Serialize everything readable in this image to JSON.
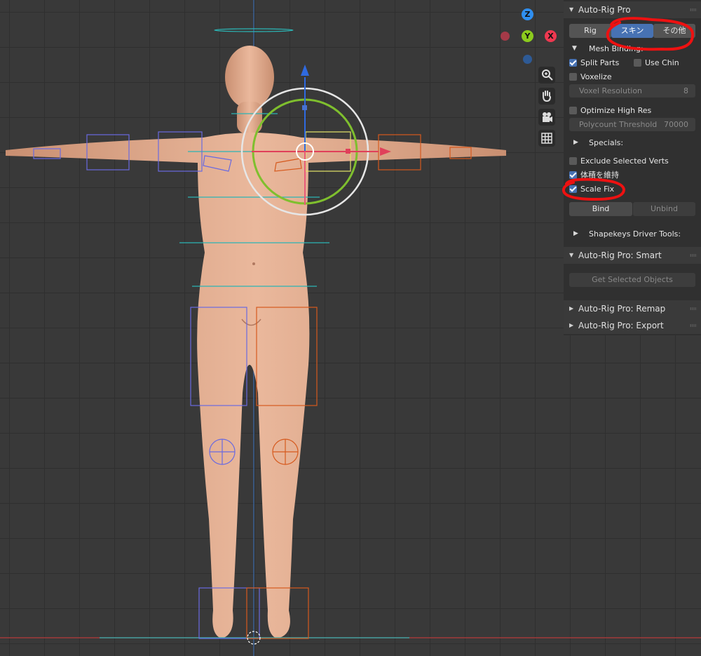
{
  "colors": {
    "x_axis": "#ef3850",
    "y_axis": "#8ccc1e",
    "z_axis": "#2f8ff0",
    "annotation": "#ee1111",
    "active_tab": "#4772b3"
  },
  "gizmo": {
    "z_label": "Z",
    "y_label": "Y",
    "x_label": "X"
  },
  "view_tools": [
    "zoom-icon",
    "hand-icon",
    "camera-icon",
    "grid-icon"
  ],
  "panel": {
    "title": "Auto-Rig Pro",
    "tabs": [
      {
        "label": "Rig",
        "active": false
      },
      {
        "label": "スキン",
        "active": true
      },
      {
        "label": "その他",
        "active": false
      }
    ],
    "mesh_binding": {
      "label": "Mesh Binding:",
      "split_parts": {
        "label": "Split Parts",
        "checked": true
      },
      "use_chin": {
        "label": "Use Chin",
        "checked": false
      },
      "voxelize": {
        "label": "Voxelize",
        "checked": false
      },
      "voxel_resolution": {
        "label": "Voxel Resolution",
        "value": "8"
      },
      "optimize_high_res": {
        "label": "Optimize High Res",
        "checked": false
      },
      "polycount_threshold": {
        "label": "Polycount Threshold",
        "value": "70000"
      }
    },
    "specials": {
      "label": "Specials:",
      "exclude_selected_verts": {
        "label": "Exclude Selected Verts",
        "checked": false
      },
      "preserve_volume": {
        "label": "体積を維持",
        "checked": true
      },
      "scale_fix": {
        "label": "Scale Fix",
        "checked": true
      }
    },
    "bind_label": "Bind",
    "unbind_label": "Unbind",
    "shapekeys_label": "Shapekeys Driver Tools:",
    "smart": {
      "title": "Auto-Rig Pro: Smart",
      "get_selected_label": "Get Selected Objects"
    },
    "remap_title": "Auto-Rig Pro: Remap",
    "export_title": "Auto-Rig Pro: Export"
  }
}
